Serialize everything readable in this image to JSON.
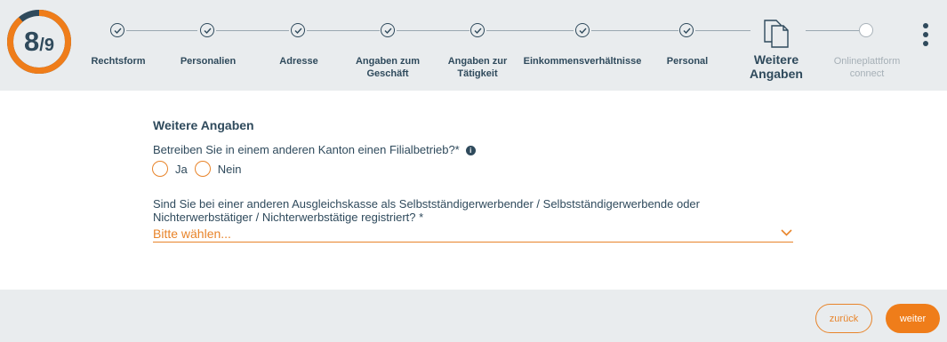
{
  "progress": {
    "current": "8",
    "total": "/9",
    "fraction": 0.889,
    "ring_color": "#ef7d1a",
    "track_color": "#2f4a5c"
  },
  "steps": [
    {
      "label": "Rechtsform",
      "status": "done"
    },
    {
      "label": "Personalien",
      "status": "done"
    },
    {
      "label": "Adresse",
      "status": "done"
    },
    {
      "label": "Angaben zum\nGeschäft",
      "status": "done"
    },
    {
      "label": "Angaben zur\nTätigkeit",
      "status": "done"
    },
    {
      "label": "Einkommensverhältnisse",
      "status": "done"
    },
    {
      "label": "Personal",
      "status": "done"
    },
    {
      "label": "Weitere\nAngaben",
      "status": "active",
      "icon": "document-icon"
    },
    {
      "label": "Onlineplattform\nconnect",
      "status": "pending"
    }
  ],
  "form": {
    "title": "Weitere Angaben",
    "question1": "Betreiben Sie in einem anderen Kanton einen Filialbetrieb?*",
    "info_icon_glyph": "i",
    "options": {
      "yes": "Ja",
      "no": "Nein"
    },
    "question2": "Sind Sie bei einer anderen Ausgleichskasse als Selbstständigerwerbender / Selbstständigerwerbende oder Nichterwerbstätiger / Nichterwerbstätige registriert? *",
    "select_placeholder": "Bitte wählen..."
  },
  "footer": {
    "back_label": "zurück",
    "next_label": "weiter"
  },
  "colors": {
    "accent": "#ef7d1a",
    "text": "#2f4a5c",
    "header_bg": "#e9ecee"
  }
}
